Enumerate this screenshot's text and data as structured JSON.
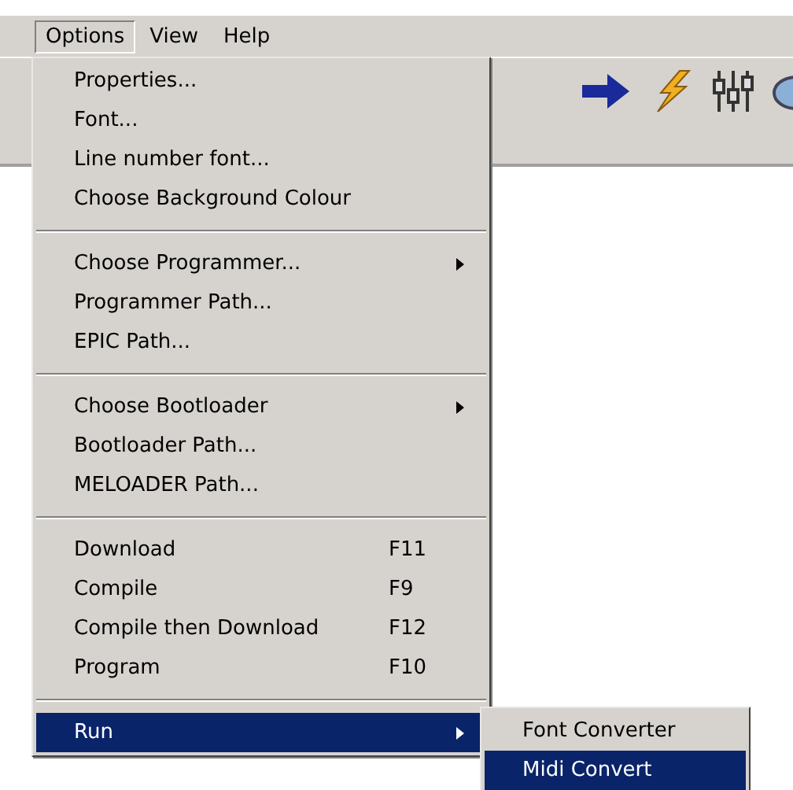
{
  "menubar": [
    {
      "label": "Options",
      "selected": true
    },
    {
      "label": "View",
      "selected": false
    },
    {
      "label": "Help",
      "selected": false
    }
  ],
  "menu": [
    {
      "kind": "item",
      "label": "Properties...",
      "submenu": false,
      "selected": false
    },
    {
      "kind": "item",
      "label": "Font...",
      "submenu": false,
      "selected": false
    },
    {
      "kind": "item",
      "label": "Line number font...",
      "submenu": false,
      "selected": false
    },
    {
      "kind": "item",
      "label": "Choose Background Colour",
      "submenu": false,
      "selected": false
    },
    {
      "kind": "separator"
    },
    {
      "kind": "item",
      "label": "Choose Programmer...",
      "submenu": true,
      "selected": false
    },
    {
      "kind": "item",
      "label": "Programmer Path...",
      "submenu": false,
      "selected": false
    },
    {
      "kind": "item",
      "label": "EPIC Path...",
      "submenu": false,
      "selected": false
    },
    {
      "kind": "separator"
    },
    {
      "kind": "item",
      "label": "Choose Bootloader",
      "submenu": true,
      "selected": false
    },
    {
      "kind": "item",
      "label": "Bootloader Path...",
      "submenu": false,
      "selected": false
    },
    {
      "kind": "item",
      "label": "MELOADER Path...",
      "submenu": false,
      "selected": false
    },
    {
      "kind": "separator"
    },
    {
      "kind": "item",
      "label": "Download",
      "shortcut": "F11",
      "submenu": false,
      "selected": false
    },
    {
      "kind": "item",
      "label": "Compile",
      "shortcut": "F9",
      "submenu": false,
      "selected": false
    },
    {
      "kind": "item",
      "label": "Compile then Download",
      "shortcut": "F12",
      "submenu": false,
      "selected": false
    },
    {
      "kind": "item",
      "label": "Program",
      "shortcut": "F10",
      "submenu": false,
      "selected": false
    },
    {
      "kind": "separator"
    },
    {
      "kind": "item",
      "label": "Run",
      "submenu": true,
      "selected": true
    }
  ],
  "submenu": [
    {
      "label": "Font Converter",
      "selected": false
    },
    {
      "label": "Midi Convert",
      "selected": true
    }
  ]
}
